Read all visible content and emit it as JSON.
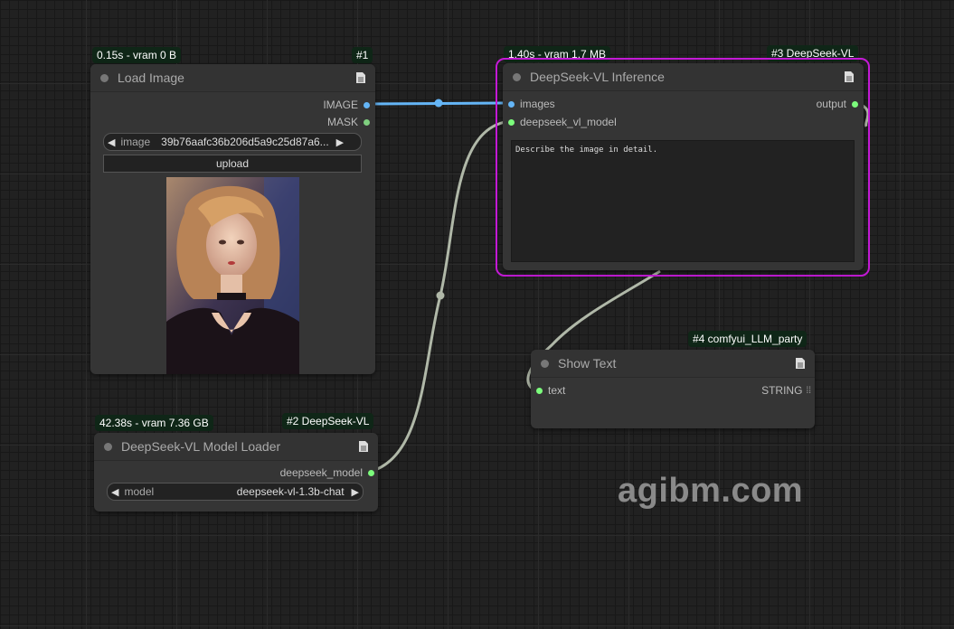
{
  "nodes": {
    "load_image": {
      "title": "Load Image",
      "badge_time": "0.15s - vram 0 B",
      "badge_id": "#1",
      "outputs": [
        "IMAGE",
        "MASK"
      ],
      "widget_label": "image",
      "widget_value": "39b76aafc36b206d5a9c25d87a6...",
      "button": "upload"
    },
    "model_loader": {
      "title": "DeepSeek-VL Model Loader",
      "badge_time": "42.38s - vram 7.36 GB",
      "badge_id": "#2 DeepSeek-VL",
      "output": "deepseek_model",
      "widget_label": "model",
      "widget_value": "deepseek-vl-1.3b-chat"
    },
    "inference": {
      "title": "DeepSeek-VL Inference",
      "badge_time": "1.40s - vram 1.7 MB",
      "badge_id": "#3 DeepSeek-VL",
      "inputs": [
        "images",
        "deepseek_vl_model"
      ],
      "output": "output",
      "prompt": "Describe the image in detail."
    },
    "show_text": {
      "title": "Show Text",
      "badge_id": "#4 comfyui_LLM_party",
      "input": "text",
      "output": "STRING"
    }
  },
  "colors": {
    "image_link": "#64b5f6",
    "model_link": "#b0b8a8",
    "selected_border": "#c41ad6",
    "slot_green": "#7cfc7c",
    "badge_bg": "#0f2617"
  },
  "watermark": "agibm.com"
}
